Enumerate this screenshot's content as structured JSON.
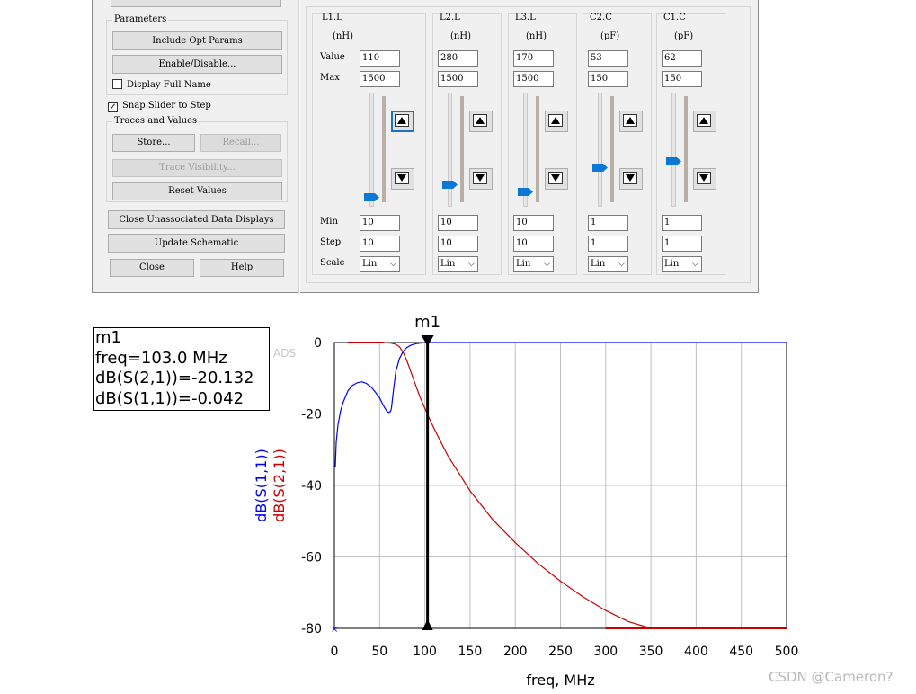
{
  "left_panel": {
    "parameters_title": "Parameters",
    "include_opt": "Include Opt Params",
    "enable_disable": "Enable/Disable...",
    "display_full_name": "Display Full Name",
    "display_full_name_checked": false,
    "snap_slider": "Snap Slider to Step",
    "snap_slider_checked": true,
    "traces_title": "Traces and Values",
    "store": "Store...",
    "recall": "Recall...",
    "trace_visibility": "Trace Visibility...",
    "reset_values": "Reset Values",
    "close_unassociated": "Close Unassociated Data Displays",
    "update_schematic": "Update Schematic",
    "close": "Close",
    "help": "Help"
  },
  "row_labels": {
    "value": "Value",
    "max": "Max",
    "min": "Min",
    "step": "Step",
    "scale": "Scale"
  },
  "params": [
    {
      "name": "L1.L",
      "unit": "(nH)",
      "value": "110",
      "max": "1500",
      "min": "10",
      "step": "10",
      "scale": "Lin",
      "slider_level": 0.06
    },
    {
      "name": "L2.L",
      "unit": "(nH)",
      "value": "280",
      "max": "1500",
      "min": "10",
      "step": "10",
      "scale": "Lin",
      "slider_level": 0.18
    },
    {
      "name": "L3.L",
      "unit": "(nH)",
      "value": "170",
      "max": "1500",
      "min": "10",
      "step": "10",
      "scale": "Lin",
      "slider_level": 0.11
    },
    {
      "name": "C2.C",
      "unit": "(pF)",
      "value": "53",
      "max": "150",
      "min": "1",
      "step": "1",
      "scale": "Lin",
      "slider_level": 0.35
    },
    {
      "name": "C1.C",
      "unit": "(pF)",
      "value": "62",
      "max": "150",
      "min": "1",
      "step": "1",
      "scale": "Lin",
      "slider_level": 0.41
    }
  ],
  "marker": {
    "name": "m1",
    "freq": "freq=103.0 MHz",
    "s21": "dB(S(2,1))=-20.132",
    "s11": "dB(S(1,1))=-0.042"
  },
  "ads_ghost": "ADS",
  "watermark": "CSDN @Cameron?",
  "colors": {
    "s11": "#0000ff",
    "s21": "#cc0000",
    "grid": "#c0c0c0",
    "slider_thumb": "#0a78d7"
  },
  "chart_data": {
    "type": "line",
    "xlabel": "freq, MHz",
    "xlim": [
      0,
      500
    ],
    "ylim": [
      -80,
      0
    ],
    "xticks": [
      0,
      50,
      100,
      150,
      200,
      250,
      300,
      350,
      400,
      450,
      500
    ],
    "yticks": [
      0,
      -20,
      -40,
      -60,
      -80
    ],
    "grid": true,
    "marker_x": 103,
    "series": [
      {
        "name": "dB(S(1,1))",
        "x": [
          1,
          2,
          4,
          7,
          10,
          15,
          20,
          25,
          30,
          35,
          40,
          45,
          50,
          55,
          58,
          60,
          62,
          63,
          65,
          68,
          72,
          76,
          80,
          85,
          90,
          95,
          100,
          103,
          110,
          150,
          200,
          300,
          400,
          500
        ],
        "y": [
          -35,
          -28,
          -23,
          -19,
          -16.5,
          -13.5,
          -12,
          -11.3,
          -11,
          -11.4,
          -12.3,
          -13.8,
          -15.5,
          -18,
          -19.2,
          -19.6,
          -19.3,
          -18.5,
          -14,
          -8,
          -4.5,
          -2.5,
          -1.4,
          -0.7,
          -0.35,
          -0.15,
          -0.06,
          -0.042,
          -0.01,
          0,
          0,
          0,
          0,
          0
        ]
      },
      {
        "name": "dB(S(2,1))",
        "x": [
          15,
          30,
          45,
          55,
          62,
          68,
          72,
          76,
          80,
          85,
          90,
          95,
          103,
          110,
          125,
          150,
          175,
          200,
          225,
          250,
          275,
          300,
          325,
          350,
          360,
          400,
          450,
          500
        ],
        "y": [
          0,
          0,
          -0.01,
          -0.05,
          -0.15,
          -0.5,
          -1.2,
          -2.8,
          -5,
          -8.5,
          -12,
          -15.5,
          -20.132,
          -24,
          -31.5,
          -41.5,
          -49.5,
          -56,
          -61.8,
          -66.8,
          -71.2,
          -75,
          -78.1,
          -80,
          -80,
          -80,
          -80,
          -80
        ]
      }
    ]
  }
}
